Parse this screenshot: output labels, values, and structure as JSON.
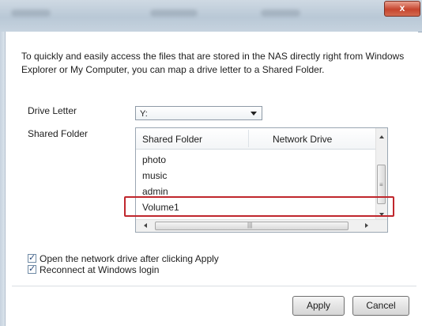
{
  "titlebar": {
    "close_glyph": "x"
  },
  "dialog": {
    "intro": "To quickly and easily access the files that are stored in the NAS directly right from Windows Explorer or My Computer, you can map a drive letter to a Shared Folder.",
    "drive_letter_label": "Drive Letter",
    "drive_letter_value": "Y:",
    "shared_folder_label": "Shared Folder",
    "table": {
      "columns": [
        "Shared Folder",
        "Network Drive"
      ],
      "rows": [
        "photo",
        "music",
        "admin",
        "Volume1"
      ],
      "highlighted_row": "Volume1"
    },
    "checkboxes": [
      {
        "label": "Open the network drive after clicking Apply",
        "checked": true
      },
      {
        "label": "Reconnect at Windows login",
        "checked": true
      }
    ],
    "buttons": {
      "apply": "Apply",
      "cancel": "Cancel"
    }
  },
  "colors": {
    "highlight_border": "#c0272d",
    "close_button": "#c6452e"
  }
}
